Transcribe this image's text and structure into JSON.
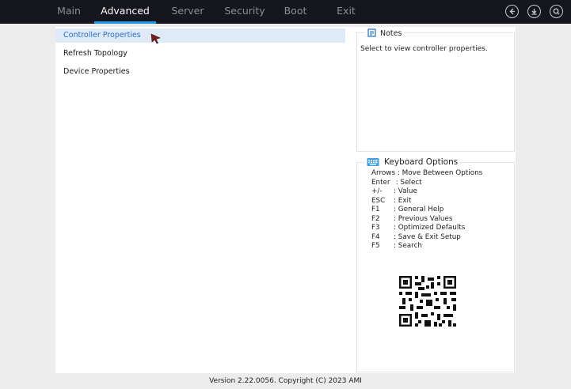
{
  "tabs": [
    {
      "label": "Main",
      "active": false
    },
    {
      "label": "Advanced",
      "active": true
    },
    {
      "label": "Server",
      "active": false
    },
    {
      "label": "Security",
      "active": false
    },
    {
      "label": "Boot",
      "active": false
    },
    {
      "label": "Exit",
      "active": false
    }
  ],
  "toolbar_icons": [
    "back-icon",
    "download-icon",
    "search-icon"
  ],
  "menu": {
    "items": [
      {
        "label": "Controller Properties",
        "selected": true
      },
      {
        "label": "Refresh Topology",
        "selected": false
      },
      {
        "label": "Device Properties",
        "selected": false
      }
    ]
  },
  "notes": {
    "title": "Notes",
    "text": "Select to view controller properties."
  },
  "keyboard": {
    "title": "Keyboard Options",
    "lines": [
      {
        "key": "Arrows",
        "desc": ": Move Between Options"
      },
      {
        "key": "Enter",
        "desc": ": Select"
      },
      {
        "key": "+/-",
        "desc": ": Value"
      },
      {
        "key": "ESC",
        "desc": ": Exit"
      },
      {
        "key": "F1",
        "desc": ": General Help"
      },
      {
        "key": "F2",
        "desc": ": Previous Values"
      },
      {
        "key": "F3",
        "desc": ": Optimized Defaults"
      },
      {
        "key": "F4",
        "desc": ": Save & Exit Setup"
      },
      {
        "key": "F5",
        "desc": ": Search"
      }
    ]
  },
  "footer": {
    "text": "Version 2.22.0056. Copyright (C) 2023 AMI"
  },
  "colors": {
    "topbar": "#16161e",
    "accent": "#1e9be6",
    "selected_bg": "#dfeaf7",
    "selected_text": "#2a6fd1"
  }
}
